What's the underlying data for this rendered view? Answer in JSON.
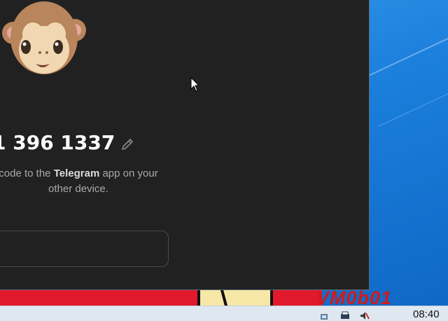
{
  "dialog": {
    "phone_number": "1 396 1337",
    "description_before": "code to the ",
    "description_app": "Telegram",
    "description_after": " app on your",
    "description_line2": "other device.",
    "code_input_value": ""
  },
  "taskbar": {
    "clock": "08:40"
  },
  "wallpaper": {
    "text": "VM0b01"
  },
  "colors": {
    "window_bg": "#212121",
    "desktop_blue": "#1b7fdc",
    "accent_red": "#e0192c"
  },
  "icons": [
    "monkey-emoji-icon",
    "edit-pencil-icon",
    "mouse-cursor-icon",
    "network-tray-icon",
    "printer-tray-icon",
    "volume-muted-tray-icon"
  ]
}
